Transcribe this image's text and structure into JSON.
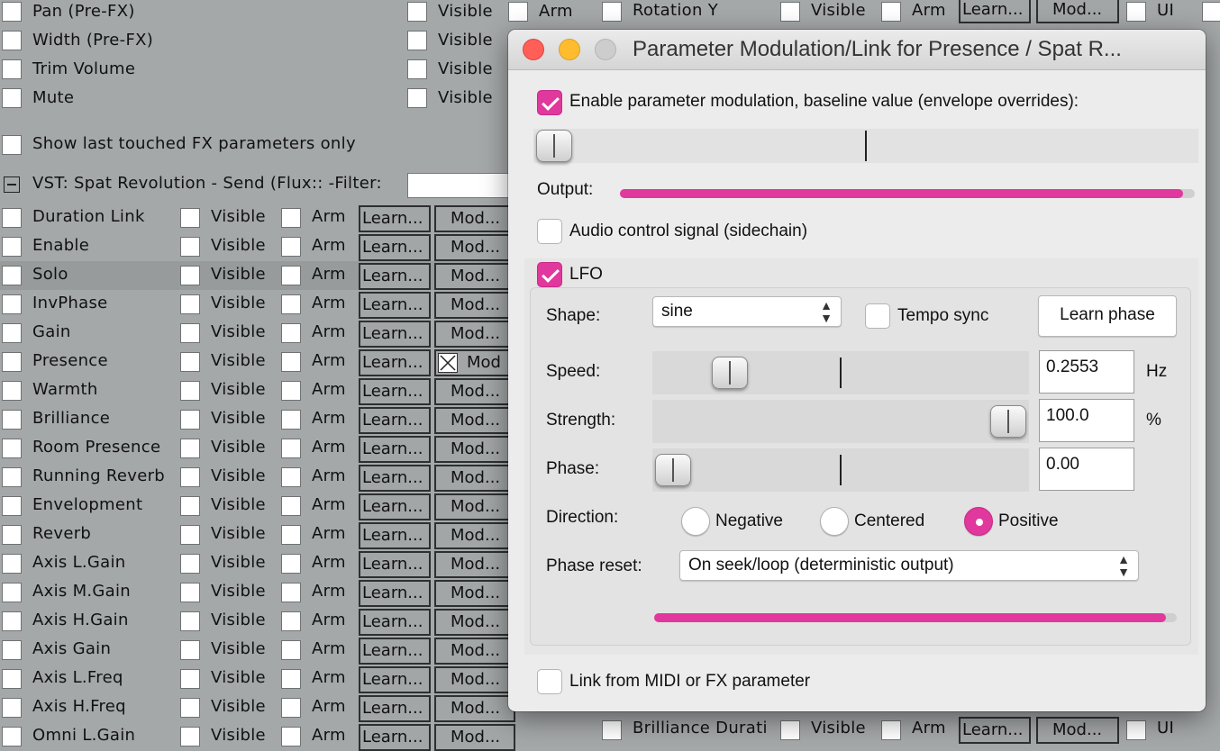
{
  "background": {
    "top_rows": [
      {
        "label": "Pan (Pre-FX)"
      },
      {
        "label": "Width (Pre-FX)"
      },
      {
        "label": "Trim Volume"
      },
      {
        "label": "Mute"
      }
    ],
    "visible_label": "Visible",
    "arm_label": "Arm",
    "learn_label": "Learn...",
    "mod_label": "Mod...",
    "mod_checked_label": "Mod",
    "right_row": {
      "label": "Rotation Y",
      "ui_label": "UI"
    },
    "bottom_right_row": {
      "label": "Brilliance Durati",
      "ui_label": "UI"
    },
    "show_last_touched": "Show last touched FX parameters only",
    "vst_header": "VST: Spat Revolution - Send (Flux:: -Filter:",
    "collapse_icon": "minus-box-icon",
    "params": [
      "Duration Link",
      "Enable",
      "Solo",
      "InvPhase",
      "Gain",
      "Presence",
      "Warmth",
      "Brilliance",
      "Room Presence",
      "Running Reverb",
      "Envelopment",
      "Reverb",
      "Axis L.Gain",
      "Axis M.Gain",
      "Axis H.Gain",
      "Axis Gain",
      "Axis L.Freq",
      "Axis H.Freq",
      "Omni L.Gain"
    ],
    "highlighted_param": "Solo",
    "mod_active_param": "Presence"
  },
  "dialog": {
    "title": "Parameter Modulation/Link for Presence / Spat R...",
    "enable_label": "Enable parameter modulation, baseline value (envelope overrides):",
    "enable_checked": true,
    "baseline_fraction": 0.0,
    "output_label": "Output:",
    "output_level": 0.98,
    "audio_control_label": "Audio control signal (sidechain)",
    "audio_control_checked": false,
    "lfo_label": "LFO",
    "lfo_checked": true,
    "shape_label": "Shape:",
    "shape_value": "sine",
    "tempo_sync_label": "Tempo sync",
    "tempo_sync_checked": false,
    "learn_phase_label": "Learn phase",
    "speed_label": "Speed:",
    "speed_value": "0.2553",
    "speed_unit": "Hz",
    "speed_fraction": 0.17,
    "strength_label": "Strength:",
    "strength_value": "100.0",
    "strength_unit": "%",
    "strength_fraction": 1.0,
    "phase_label": "Phase:",
    "phase_value": "0.00",
    "phase_fraction": 0.0,
    "direction_label": "Direction:",
    "direction_options": [
      "Negative",
      "Centered",
      "Positive"
    ],
    "direction_selected": "Positive",
    "phase_reset_label": "Phase reset:",
    "phase_reset_value": "On seek/loop (deterministic output)",
    "lfo_output_level": 0.98,
    "link_label": "Link from MIDI or FX parameter",
    "link_checked": false,
    "colors": {
      "accent": "#e0389c",
      "close": "#ff5f57",
      "minimize": "#febc2e",
      "zoom": "#cdcdcd"
    }
  }
}
